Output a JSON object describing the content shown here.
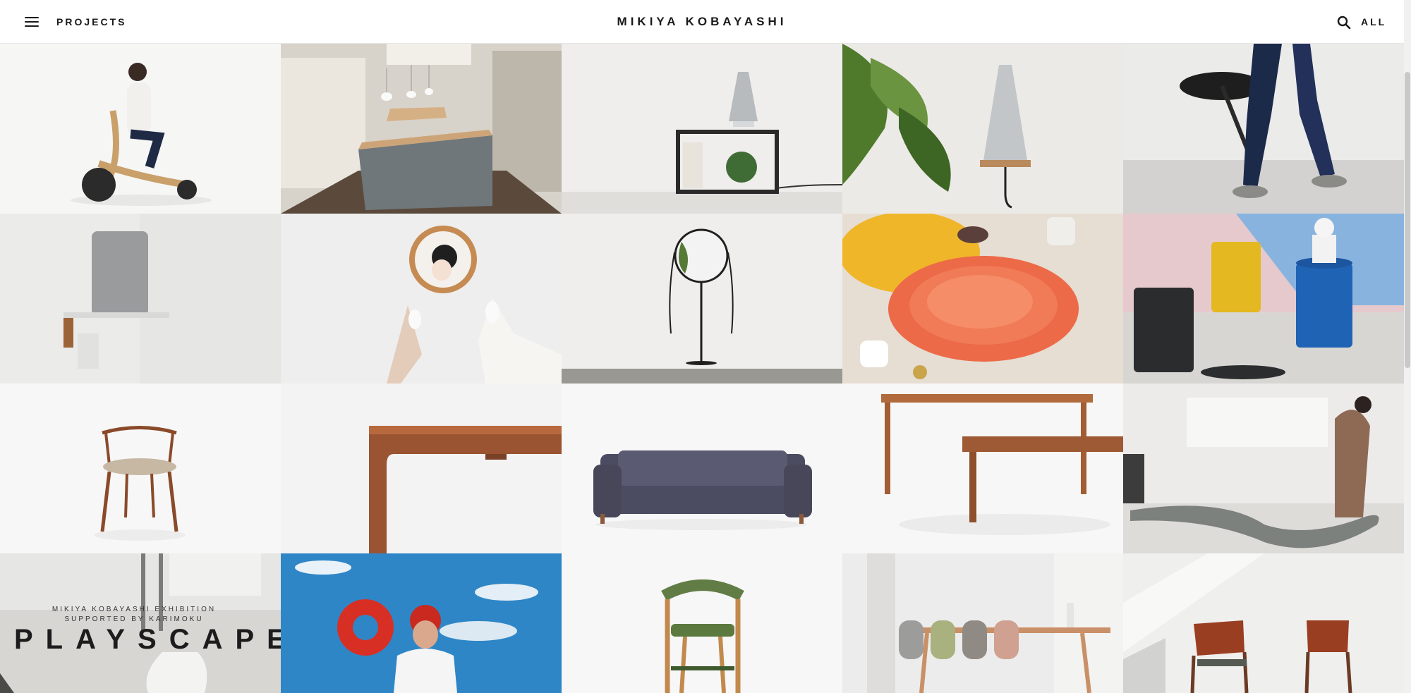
{
  "header": {
    "menu_icon": "hamburger-menu-icon",
    "nav_label": "PROJECTS",
    "brand": "MIKIYA KOBAYASHI",
    "search_icon": "search-icon",
    "filter_label": "ALL"
  },
  "poster": {
    "subtitle_line1": "MIKIYA KOBAYASHI EXHIBITION",
    "subtitle_line2": "SUPPORTED BY KARIMOKU",
    "title": "PLAYSCAPE"
  },
  "projects": [
    {
      "image": "mobility-scooter-with-rider"
    },
    {
      "image": "restaurant-counter-interior"
    },
    {
      "image": "speaker-on-black-shelf"
    },
    {
      "image": "pendant-speaker-with-plant"
    },
    {
      "image": "walking-stool"
    },
    {
      "image": "wall-speaker-on-wood-shelf"
    },
    {
      "image": "hand-mirror-held-by-woman"
    },
    {
      "image": "standing-mirror"
    },
    {
      "image": "nesting-colored-trays"
    },
    {
      "image": "mesh-stools-and-bust"
    },
    {
      "image": "wooden-dining-chair"
    },
    {
      "image": "table-corner-detail"
    },
    {
      "image": "grey-sofa"
    },
    {
      "image": "wooden-table-and-bench"
    },
    {
      "image": "curved-bench-with-people"
    },
    {
      "image": "playscape-exhibition-poster"
    },
    {
      "image": "swimmer-with-red-ring"
    },
    {
      "image": "rattan-bistro-chair"
    },
    {
      "image": "dining-chairs-row"
    },
    {
      "image": "armchairs-in-sunlight"
    }
  ]
}
